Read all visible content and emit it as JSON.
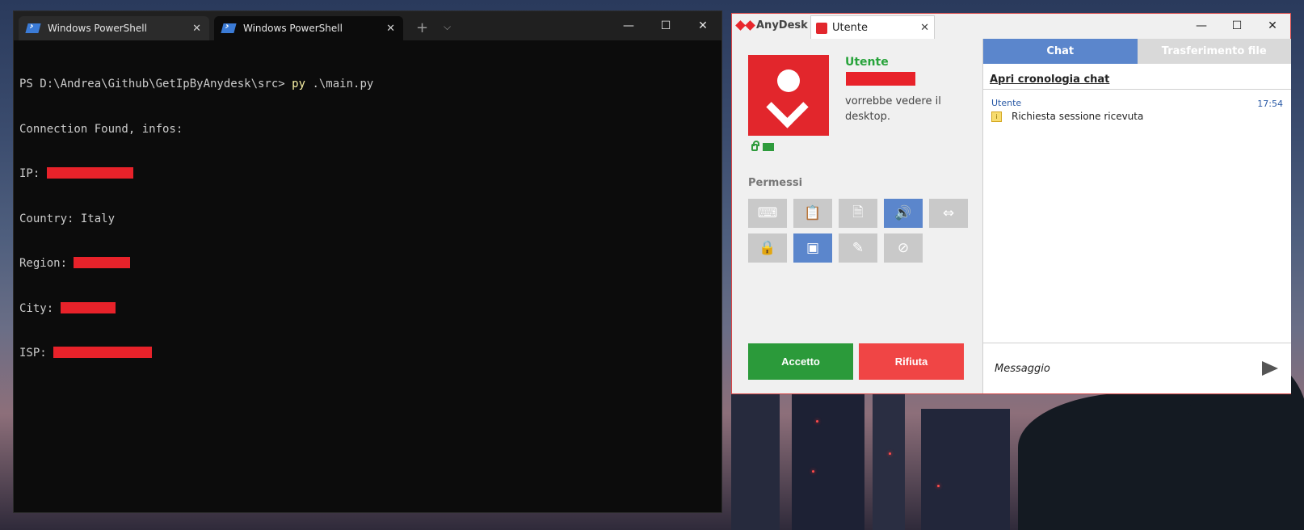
{
  "terminal": {
    "tabs": [
      {
        "label": "Windows PowerShell"
      },
      {
        "label": "Windows PowerShell"
      }
    ],
    "add_tab": "+",
    "dropdown": "⌵",
    "minimize": "—",
    "maximize": "☐",
    "close": "✕",
    "lines": {
      "prompt": "PS D:\\Andrea\\Github\\GetIpByAnydesk\\src> ",
      "command_py": "py",
      "command_rest": " .\\main.py",
      "found": "Connection Found, infos:",
      "ip_label": "IP: ",
      "country": "Country: Italy",
      "region_label": "Region: ",
      "city_label": "City: ",
      "isp_label": "ISP: "
    }
  },
  "anydesk": {
    "app_name": "AnyDesk",
    "tab_label": "Utente",
    "tab_close": "✕",
    "minimize": "—",
    "maximize": "☐",
    "close": "✕",
    "user_name": "Utente",
    "request_text": "vorrebbe vedere il desktop.",
    "permissions_title": "Permessi",
    "permissions": [
      {
        "icon": "keyboard-mouse-icon",
        "glyph": "⌨",
        "active": false
      },
      {
        "icon": "clipboard-icon",
        "glyph": "📋",
        "active": false
      },
      {
        "icon": "file-transfer-icon",
        "glyph": "🗎",
        "active": false
      },
      {
        "icon": "sound-icon",
        "glyph": "🔊",
        "active": true
      },
      {
        "icon": "control-icon",
        "glyph": "⇔",
        "active": false
      },
      {
        "icon": "lock-screen-icon",
        "glyph": "🔒",
        "active": false
      },
      {
        "icon": "record-icon",
        "glyph": "▣",
        "active": true
      },
      {
        "icon": "draw-icon",
        "glyph": "✎",
        "active": false
      },
      {
        "icon": "privacy-icon",
        "glyph": "⊘",
        "active": false
      }
    ],
    "accept_label": "Accetto",
    "reject_label": "Rifiuta",
    "chat_tab": "Chat",
    "transfer_tab": "Trasferimento file",
    "history_link": "Apri cronologia chat",
    "message": {
      "author": "Utente",
      "time": "17:54",
      "text": "Richiesta sessione ricevuta"
    },
    "input_placeholder": "Messaggio"
  },
  "colors": {
    "accent_red": "#e2262c",
    "accept_green": "#2b9a3a",
    "reject_red": "#f04545",
    "active_blue": "#5b86cc"
  }
}
